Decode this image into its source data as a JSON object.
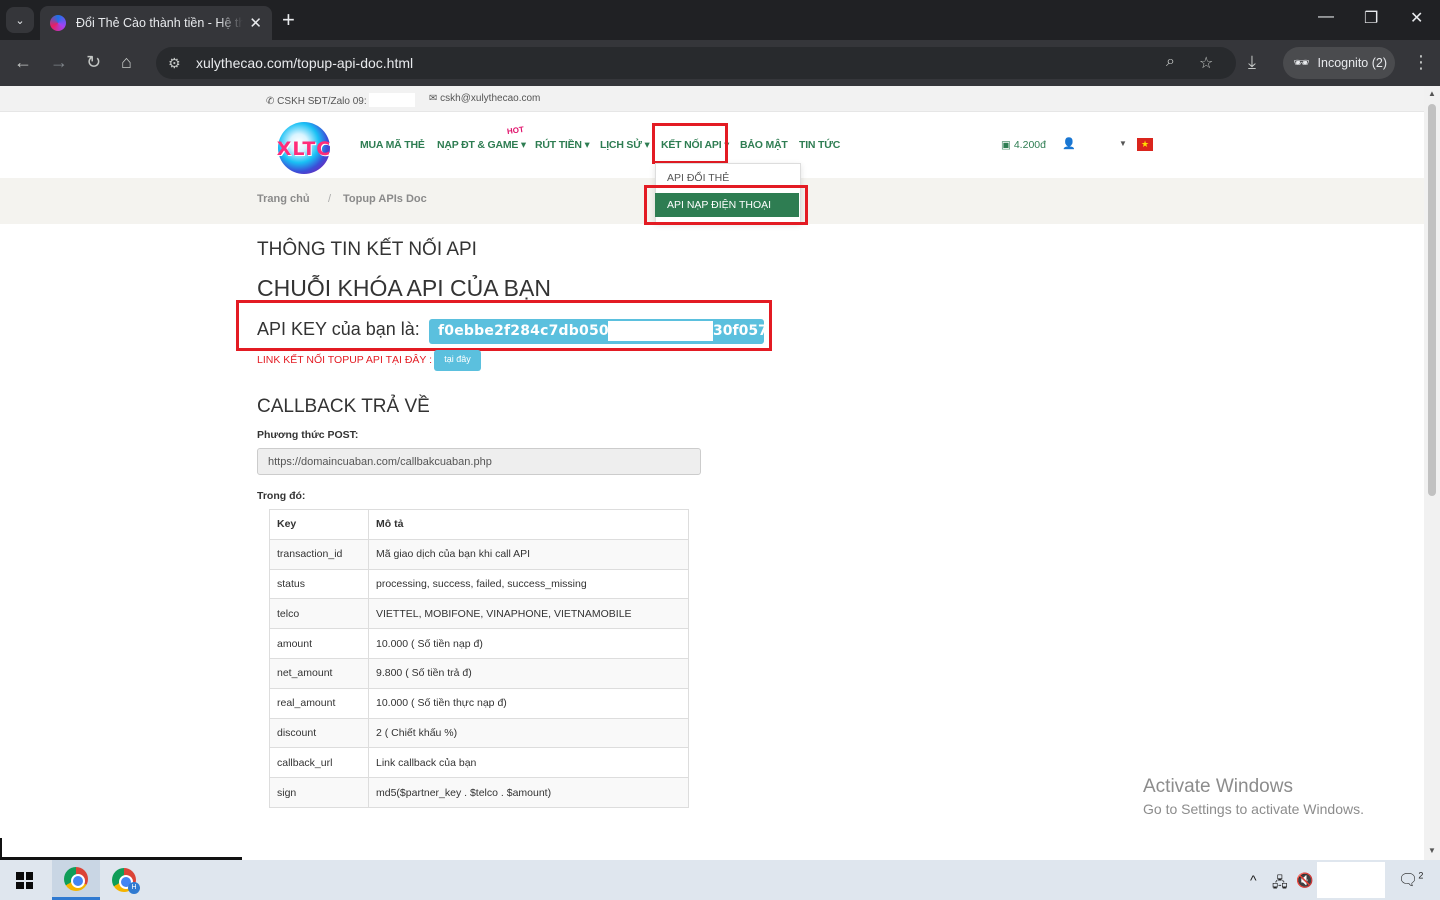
{
  "browser": {
    "tab_title": "Đổi Thẻ Cào thành tiền - Hệ thống",
    "url": "xulythecao.com/topup-api-doc.html",
    "profile_label": "Incognito (2)"
  },
  "topbar": {
    "phone": "CSKH SĐT/Zalo 09:",
    "email": "cskh@xulythecao.com"
  },
  "logo": {
    "text": "XLTC"
  },
  "nav": {
    "buy_card": "MUA MÃ THẺ",
    "topup": "NẠP ĐT & GAME",
    "hot_badge": "HOT",
    "withdraw": "RÚT TIỀN",
    "history": "LỊCH SỬ",
    "api": "KẾT NỐI API",
    "security": "BẢO MẬT",
    "news": "TIN TỨC",
    "balance": "4.200đ"
  },
  "dropdown": {
    "item1": "API ĐỔI THẺ",
    "item2": "API NẠP ĐIỆN THOẠI"
  },
  "breadcrumb": {
    "home": "Trang chủ",
    "sep": "/",
    "current": "Topup APIs Doc"
  },
  "content": {
    "heading_info": "THÔNG TIN KẾT NỐI API",
    "heading_key": "CHUỖI KHÓA API CỦA BẠN",
    "apikey_label": "API KEY của bạn là:",
    "apikey_prefix": "f0ebbe2f284c7db05029eb",
    "apikey_suffix": "30f057",
    "link_label": "LINK KẾT NỐI TOPUP API TẠI ĐÂY :",
    "link_button": "tại đây",
    "heading_callback": "CALLBACK TRẢ VỀ",
    "post_label": "Phương thức POST:",
    "callback_url": "https://domaincuaban.com/callbakcuaban.php",
    "trong_do": "Trong đó:"
  },
  "table": {
    "headers": [
      "Key",
      "Mô tả"
    ],
    "rows": [
      [
        "transaction_id",
        "Mã giao dịch của bạn khi call API"
      ],
      [
        "status",
        "processing, success, failed, success_missing"
      ],
      [
        "telco",
        "VIETTEL, MOBIFONE, VINAPHONE, VIETNAMOBILE"
      ],
      [
        "amount",
        "10.000 ( Số tiền nạp đ)"
      ],
      [
        "net_amount",
        "9.800 ( Số tiền trả đ)"
      ],
      [
        "real_amount",
        "10.000 ( Số tiền thực nạp đ)"
      ],
      [
        "discount",
        "2 ( Chiết khấu %)"
      ],
      [
        "callback_url",
        "Link callback của bạn"
      ],
      [
        "sign",
        "md5($partner_key . $telco . $amount)"
      ]
    ]
  },
  "watermark": {
    "title": "Activate Windows",
    "subtitle": "Go to Settings to activate Windows."
  },
  "taskbar": {
    "notif_count": "2",
    "chrome_badge": "H"
  },
  "colors": {
    "brand_green": "#2e7d52",
    "highlight_red": "#e31b23",
    "info_blue": "#5bc0de"
  }
}
